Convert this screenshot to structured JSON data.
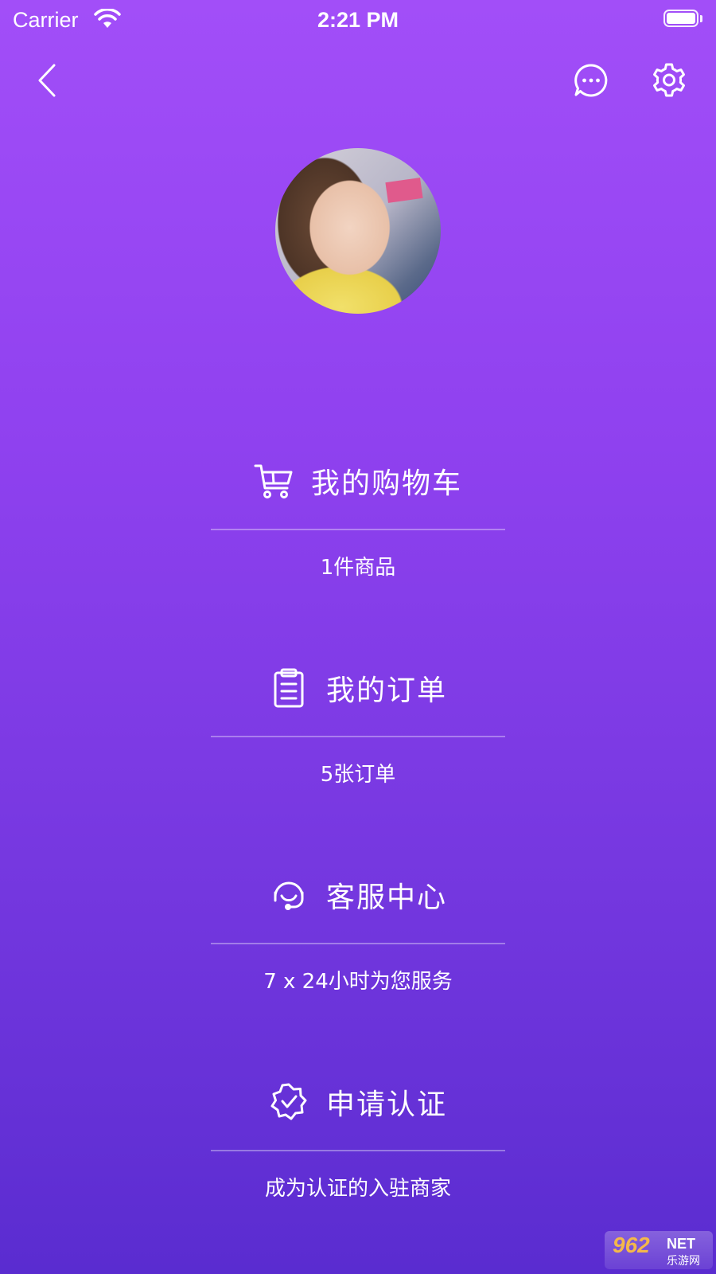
{
  "status_bar": {
    "carrier": "Carrier",
    "time": "2:21 PM"
  },
  "nav": {
    "back_icon": "chevron-left-icon",
    "message_icon": "chat-bubble-icon",
    "settings_icon": "gear-icon"
  },
  "profile": {
    "avatar": "user-avatar-photo"
  },
  "menu": [
    {
      "icon": "cart-icon",
      "title": "我的购物车",
      "subtitle": "1件商品"
    },
    {
      "icon": "clipboard-icon",
      "title": "我的订单",
      "subtitle": "5张订单"
    },
    {
      "icon": "headset-icon",
      "title": "客服中心",
      "subtitle": "7 x 24小时为您服务"
    },
    {
      "icon": "verified-badge-icon",
      "title": "申请认证",
      "subtitle": "成为认证的入驻商家"
    }
  ],
  "watermark": {
    "number": "962",
    "suffix": "NET",
    "site": "乐游网"
  },
  "colors": {
    "gradient_top": "#a24ef8",
    "gradient_bottom": "#5a2cd0",
    "text": "#ffffff"
  }
}
